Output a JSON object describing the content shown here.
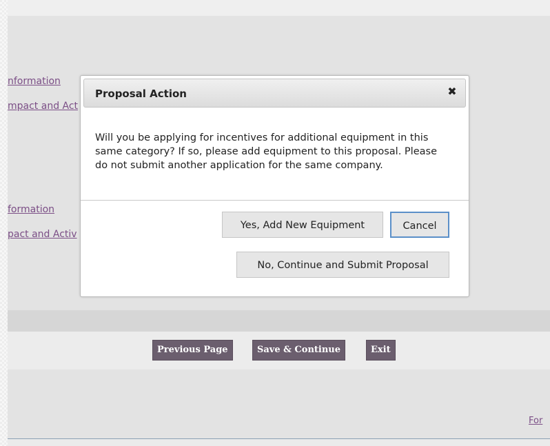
{
  "background_links": {
    "row1": "Information",
    "row2": "Impact and Activities",
    "row3": "Information",
    "row4": "Impact and Activities",
    "visible": {
      "row1": "nformation",
      "row2": "mpact and Act",
      "row3": "formation",
      "row4": "pact and Activ"
    }
  },
  "nav_buttons": {
    "previous": "Previous Page",
    "save": "Save & Continue",
    "exit": "Exit"
  },
  "footer": {
    "link_text": "For"
  },
  "dialog": {
    "title": "Proposal Action",
    "close_glyph": "✖",
    "message": "Will you be applying for incentives for additional equipment in this same category? If so, please add equipment to this proposal. Please do not submit another application for the same company.",
    "buttons": {
      "add_equipment": "Yes, Add New Equipment",
      "cancel": "Cancel",
      "continue_submit": "No, Continue and Submit Proposal"
    }
  },
  "colors": {
    "link": "#7b4e86",
    "nav_button_bg": "#6b5e6e",
    "focus_ring": "#5a8fc8"
  }
}
